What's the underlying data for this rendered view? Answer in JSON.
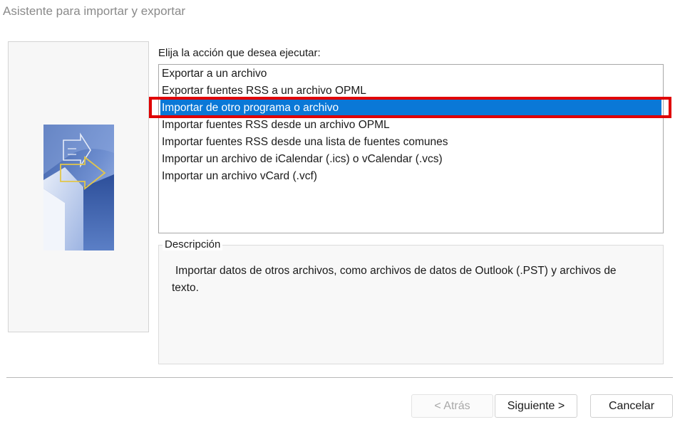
{
  "window": {
    "title": "Asistente para importar y exportar"
  },
  "main": {
    "prompt": "Elija la acción que desea ejecutar:",
    "actions": [
      {
        "label": "Exportar a un archivo",
        "selected": false
      },
      {
        "label": "Exportar fuentes RSS a un archivo OPML",
        "selected": false
      },
      {
        "label": "Importar de otro programa o archivo",
        "selected": true
      },
      {
        "label": "Importar fuentes RSS desde un archivo OPML",
        "selected": false
      },
      {
        "label": "Importar fuentes RSS desde una lista de fuentes comunes",
        "selected": false
      },
      {
        "label": "Importar un archivo de iCalendar (.ics) o vCalendar (.vcs)",
        "selected": false
      },
      {
        "label": "Importar un archivo vCard (.vcf)",
        "selected": false
      }
    ],
    "description": {
      "legend": "Descripción",
      "text": "Importar datos de otros archivos, como archivos de datos de Outlook (.PST) y archivos de texto."
    }
  },
  "footer": {
    "back_label": "< Atrás",
    "back_enabled": false,
    "next_label": "Siguiente >",
    "cancel_label": "Cancelar"
  },
  "colors": {
    "selection": "#0a78d7",
    "annotation_highlight": "#e00000"
  },
  "icons": {
    "wizard_graphic": "import-export-arrows-icon"
  }
}
